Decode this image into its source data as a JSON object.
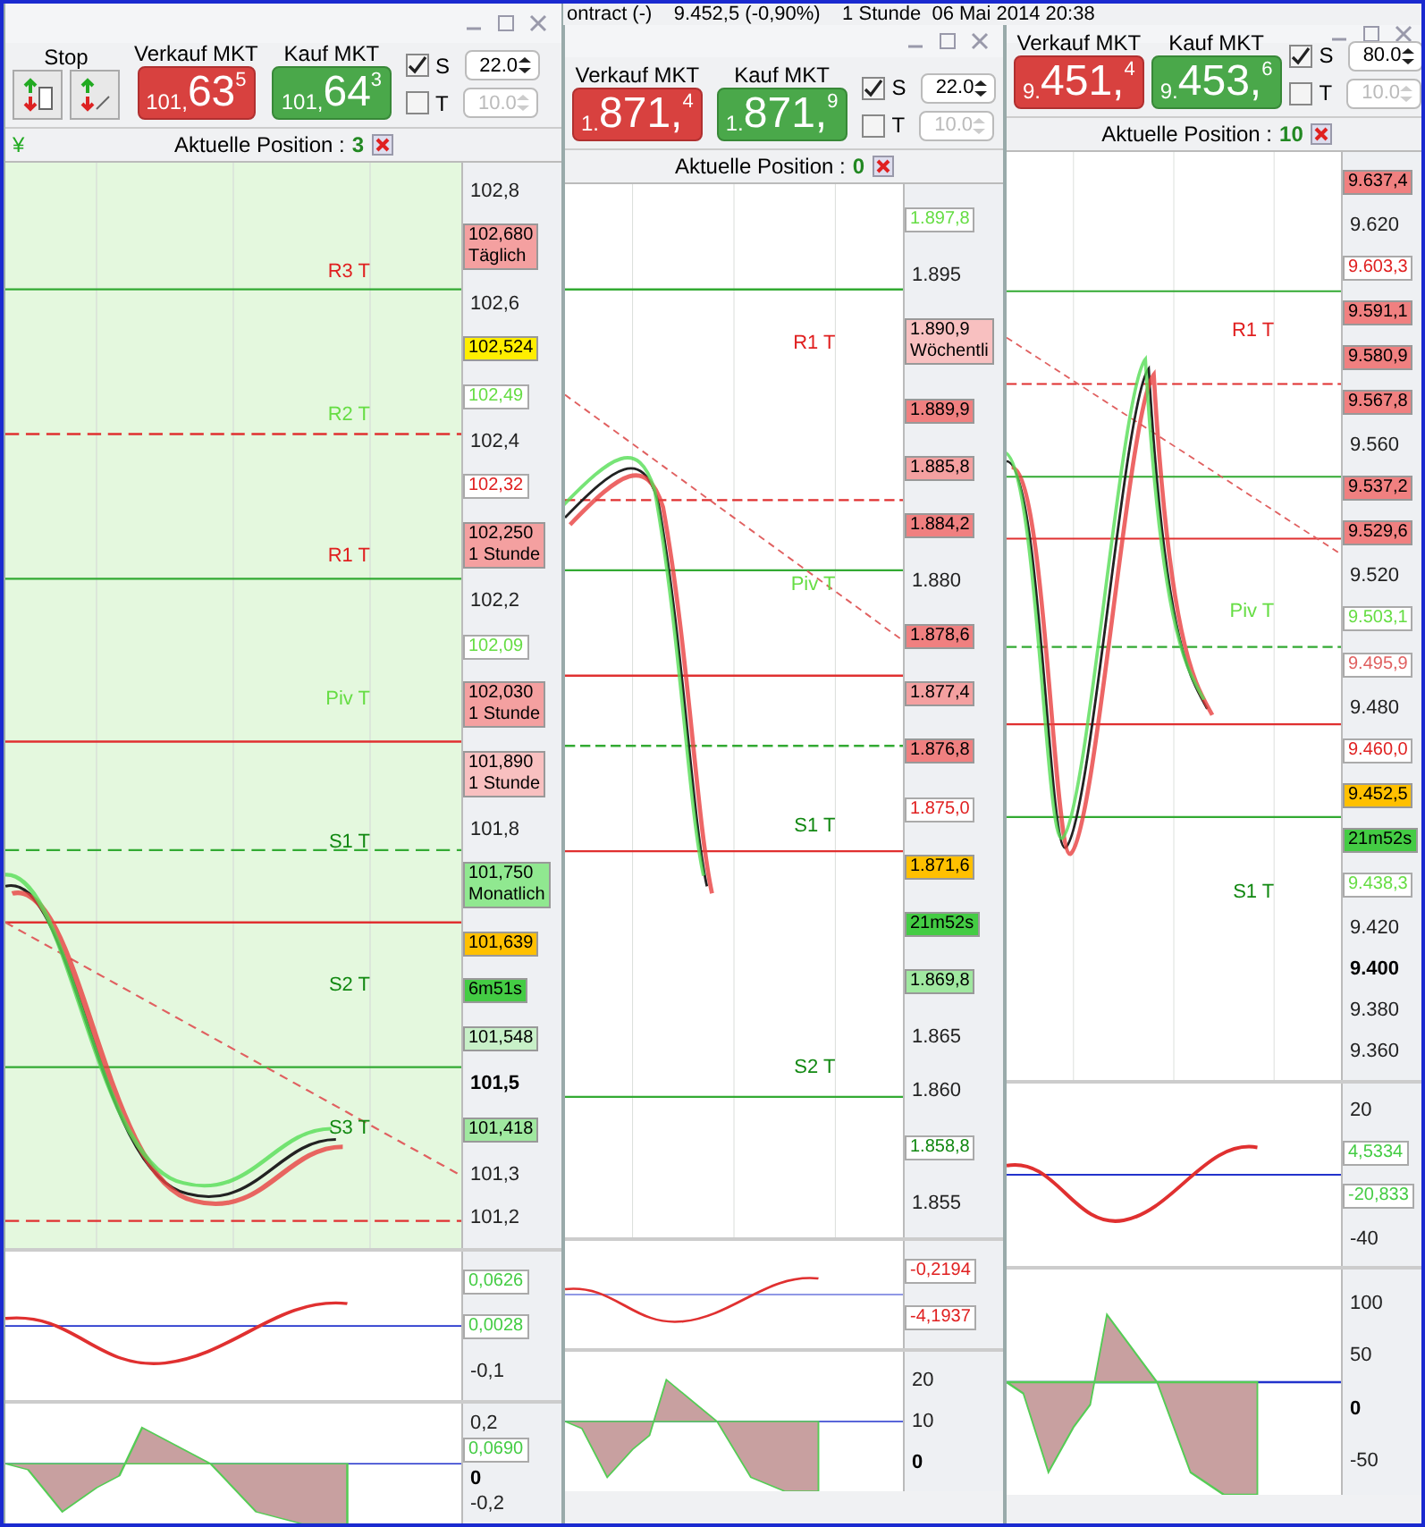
{
  "header": {
    "text": "ontract (-)    9.452,5 (-0,90%)    1 Stunde  06 Mai 2014 20:38"
  },
  "windows": [
    {
      "currency": "¥",
      "stop_label": "Stop",
      "sell": {
        "label": "Verkauf MKT",
        "prefix": "101,",
        "main": "63",
        "sup": "5"
      },
      "buy": {
        "label": "Kauf MKT",
        "prefix": "101,",
        "main": "64",
        "sup": "3"
      },
      "stop": {
        "label": "S",
        "checked": true,
        "value": "22.0"
      },
      "target": {
        "label": "T",
        "checked": false,
        "value": "10.0"
      },
      "position": {
        "label": "Aktuelle Position :",
        "count": "3"
      },
      "levels": [
        {
          "text": "R3 T",
          "color": "#e02020"
        },
        {
          "text": "R2 T",
          "color": "#66dd44"
        },
        {
          "text": "R1 T",
          "color": "#e02020"
        },
        {
          "text": "Piv T",
          "color": "#66dd44"
        },
        {
          "text": "S1 T",
          "color": "#118811"
        },
        {
          "text": "S2 T",
          "color": "#118811"
        },
        {
          "text": "S3 T",
          "color": "#118811"
        }
      ],
      "axis": [
        {
          "kind": "tick",
          "text": "102,8"
        },
        {
          "kind": "tag",
          "text": "102,680",
          "sub": "Täglich",
          "color": "#f4a0a0"
        },
        {
          "kind": "tick",
          "text": "102,6"
        },
        {
          "kind": "tag",
          "text": "102,524",
          "color": "#ffee00"
        },
        {
          "kind": "outline",
          "text": "102,49",
          "color": "#66dd44"
        },
        {
          "kind": "tick",
          "text": "102,4"
        },
        {
          "kind": "outline",
          "text": "102,32",
          "color": "#e02020"
        },
        {
          "kind": "tag",
          "text": "102,250",
          "sub": "1 Stunde",
          "color": "#f4a0a0"
        },
        {
          "kind": "tick",
          "text": "102,2"
        },
        {
          "kind": "outline",
          "text": "102,09",
          "color": "#66dd44"
        },
        {
          "kind": "tag",
          "text": "102,030",
          "sub": "1 Stunde",
          "color": "#f4a0a0"
        },
        {
          "kind": "tag",
          "text": "101,890",
          "sub": "1 Stunde",
          "color": "#f8c0c0"
        },
        {
          "kind": "tick",
          "text": "101,8"
        },
        {
          "kind": "tag",
          "text": "101,750",
          "sub": "Monatlich",
          "color": "#90e890"
        },
        {
          "kind": "tag",
          "text": "101,639",
          "color": "#ffc000"
        },
        {
          "kind": "tag",
          "text": "6m51s",
          "color": "#44cc44"
        },
        {
          "kind": "tag",
          "text": "101,548",
          "color": "#c8f0c8"
        },
        {
          "kind": "major",
          "text": "101,5"
        },
        {
          "kind": "tag",
          "text": "101,418",
          "color": "#a0e8a0"
        },
        {
          "kind": "tick",
          "text": "101,3"
        },
        {
          "kind": "tick",
          "text": "101,2"
        }
      ],
      "panels": [
        [
          {
            "kind": "outline",
            "text": "0,0626",
            "color": "#44cc44"
          },
          {
            "kind": "outline",
            "text": "0,0028",
            "color": "#44cc44"
          },
          {
            "kind": "tick",
            "text": "-0,1"
          }
        ],
        [
          {
            "kind": "tick",
            "text": "0,2"
          },
          {
            "kind": "outline",
            "text": "0,0690",
            "color": "#44cc44"
          },
          {
            "kind": "major",
            "text": "0"
          },
          {
            "kind": "tick",
            "text": "-0,2"
          }
        ]
      ]
    },
    {
      "sell": {
        "label": "Verkauf MKT",
        "prefix": "1.",
        "main": "871,",
        "sup": "4"
      },
      "buy": {
        "label": "Kauf MKT",
        "prefix": "1.",
        "main": "871,",
        "sup": "9"
      },
      "stop": {
        "label": "S",
        "checked": true,
        "value": "22.0"
      },
      "target": {
        "label": "T",
        "checked": false,
        "value": "10.0"
      },
      "position": {
        "label": "Aktuelle Position :",
        "count": "0"
      },
      "levels": [
        {
          "text": "R1 T",
          "color": "#e02020"
        },
        {
          "text": "Piv T",
          "color": "#66dd44"
        },
        {
          "text": "S1 T",
          "color": "#118811"
        },
        {
          "text": "S2 T",
          "color": "#118811"
        }
      ],
      "axis": [
        {
          "kind": "outline",
          "text": "1.897,8",
          "color": "#66dd44"
        },
        {
          "kind": "tick",
          "text": "1.895"
        },
        {
          "kind": "tag",
          "text": "1.890,9",
          "sub": "Wöchentli",
          "color": "#f8c0c0"
        },
        {
          "kind": "tag",
          "text": "1.889,9",
          "color": "#f08080"
        },
        {
          "kind": "tag",
          "text": "1.885,8",
          "color": "#f4a0a0"
        },
        {
          "kind": "tag",
          "text": "1.884,2",
          "color": "#f08080"
        },
        {
          "kind": "tick",
          "text": "1.880"
        },
        {
          "kind": "tag",
          "text": "1.878,6",
          "color": "#f08080"
        },
        {
          "kind": "tag",
          "text": "1.877,4",
          "color": "#f4a0a0"
        },
        {
          "kind": "tag",
          "text": "1.876,8",
          "color": "#f08080"
        },
        {
          "kind": "outline",
          "text": "1.875,0",
          "color": "#e02020"
        },
        {
          "kind": "tag",
          "text": "1.871,6",
          "color": "#ffc000"
        },
        {
          "kind": "tag",
          "text": "21m52s",
          "color": "#44cc44"
        },
        {
          "kind": "tag",
          "text": "1.869,8",
          "color": "#a0e8a0"
        },
        {
          "kind": "tick",
          "text": "1.865"
        },
        {
          "kind": "tick",
          "text": "1.860"
        },
        {
          "kind": "outline",
          "text": "1.858,8",
          "color": "#118811"
        },
        {
          "kind": "tick",
          "text": "1.855"
        }
      ],
      "panels": [
        [
          {
            "kind": "outline",
            "text": "-0,2194",
            "color": "#e02020"
          },
          {
            "kind": "outline",
            "text": "-4,1937",
            "color": "#e02020"
          }
        ],
        [
          {
            "kind": "tick",
            "text": "20"
          },
          {
            "kind": "tick",
            "text": "10"
          },
          {
            "kind": "major",
            "text": "0"
          }
        ]
      ]
    },
    {
      "sell": {
        "label": "Verkauf MKT",
        "prefix": "9.",
        "main": "451,",
        "sup": "4"
      },
      "buy": {
        "label": "Kauf MKT",
        "prefix": "9.",
        "main": "453,",
        "sup": "6"
      },
      "stop": {
        "label": "S",
        "checked": true,
        "value": "80.0"
      },
      "target": {
        "label": "T",
        "checked": false,
        "value": "10.0"
      },
      "position": {
        "label": "Aktuelle Position :",
        "count": "10"
      },
      "levels": [
        {
          "text": "R1 T",
          "color": "#e02020"
        },
        {
          "text": "Piv T",
          "color": "#66dd44"
        },
        {
          "text": "S1 T",
          "color": "#118811"
        }
      ],
      "axis": [
        {
          "kind": "tag",
          "text": "9.637,4",
          "color": "#f08080"
        },
        {
          "kind": "tick",
          "text": "9.620"
        },
        {
          "kind": "outline",
          "text": "9.603,3",
          "color": "#e02020"
        },
        {
          "kind": "tag",
          "text": "9.591,1",
          "color": "#f08080"
        },
        {
          "kind": "tag",
          "text": "9.580,9",
          "color": "#f08080"
        },
        {
          "kind": "tag",
          "text": "9.567,8",
          "color": "#f08080"
        },
        {
          "kind": "tick",
          "text": "9.560"
        },
        {
          "kind": "tag",
          "text": "9.537,2",
          "color": "#f08080"
        },
        {
          "kind": "tag",
          "text": "9.529,6",
          "color": "#f08080"
        },
        {
          "kind": "tick",
          "text": "9.520"
        },
        {
          "kind": "outline",
          "text": "9.503,1",
          "color": "#66dd44"
        },
        {
          "kind": "outline",
          "text": "9.495,9",
          "color": "#e06060"
        },
        {
          "kind": "tick",
          "text": "9.480"
        },
        {
          "kind": "outline",
          "text": "9.460,0",
          "color": "#e02020"
        },
        {
          "kind": "tag",
          "text": "9.452,5",
          "color": "#ffc000"
        },
        {
          "kind": "tag",
          "text": "21m52s",
          "color": "#44cc44"
        },
        {
          "kind": "outline",
          "text": "9.438,3",
          "color": "#66dd44"
        },
        {
          "kind": "tick",
          "text": "9.420"
        },
        {
          "kind": "major",
          "text": "9.400"
        },
        {
          "kind": "tick",
          "text": "9.380"
        },
        {
          "kind": "tick",
          "text": "9.360"
        }
      ],
      "panels": [
        [
          {
            "kind": "tick",
            "text": "20"
          },
          {
            "kind": "outline",
            "text": "4,5334",
            "color": "#44cc44"
          },
          {
            "kind": "outline",
            "text": "-20,833",
            "color": "#44cc44"
          },
          {
            "kind": "tick",
            "text": "-40"
          }
        ],
        [
          {
            "kind": "tick",
            "text": "100"
          },
          {
            "kind": "tick",
            "text": "50"
          },
          {
            "kind": "major",
            "text": "0"
          },
          {
            "kind": "tick",
            "text": "-50"
          }
        ]
      ]
    }
  ]
}
